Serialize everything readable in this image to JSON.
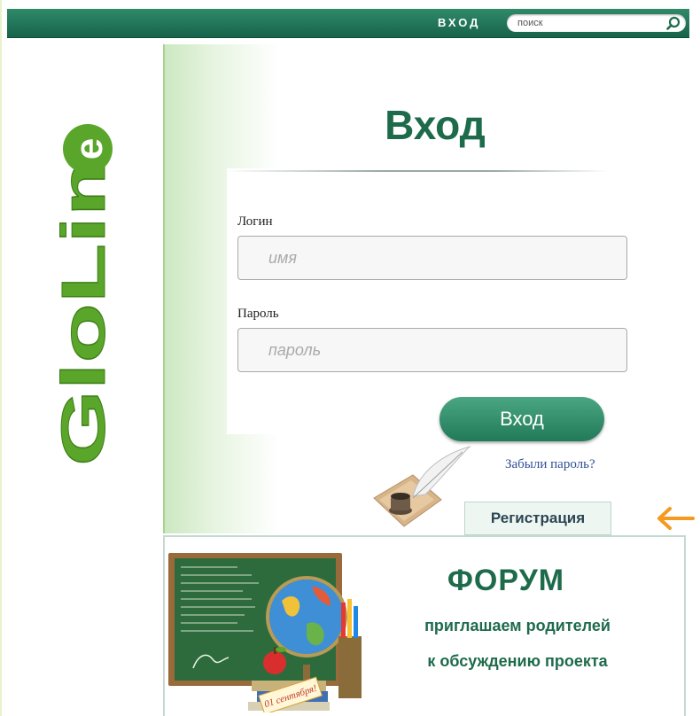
{
  "header": {
    "login_label": "ВХОД",
    "search_placeholder": "поиск"
  },
  "brand": {
    "logo_text": "GloLime",
    "colors": {
      "primary": "#1e6b4b",
      "logo_green": "#5aa62a",
      "accent_orange": "#f39a1f"
    }
  },
  "login_form": {
    "title": "Вход",
    "username_label": "Логин",
    "username_placeholder": "имя",
    "username_value": "",
    "password_label": "Пароль",
    "password_placeholder": "пароль",
    "password_value": "",
    "submit_label": "Вход",
    "forgot_password_label": "Забыли пароль?",
    "register_label": "Регистрация"
  },
  "forum_banner": {
    "title": "ФОРУМ",
    "line1": "приглашаем родителей",
    "line2": "к обсуждению проекта",
    "sticker_text": "01 сентября!"
  },
  "icons": [
    "search-icon",
    "quill-ink-icon",
    "arrow-left-icon",
    "globe-icon",
    "apple-icon",
    "books-icon",
    "pencils-icon"
  ]
}
